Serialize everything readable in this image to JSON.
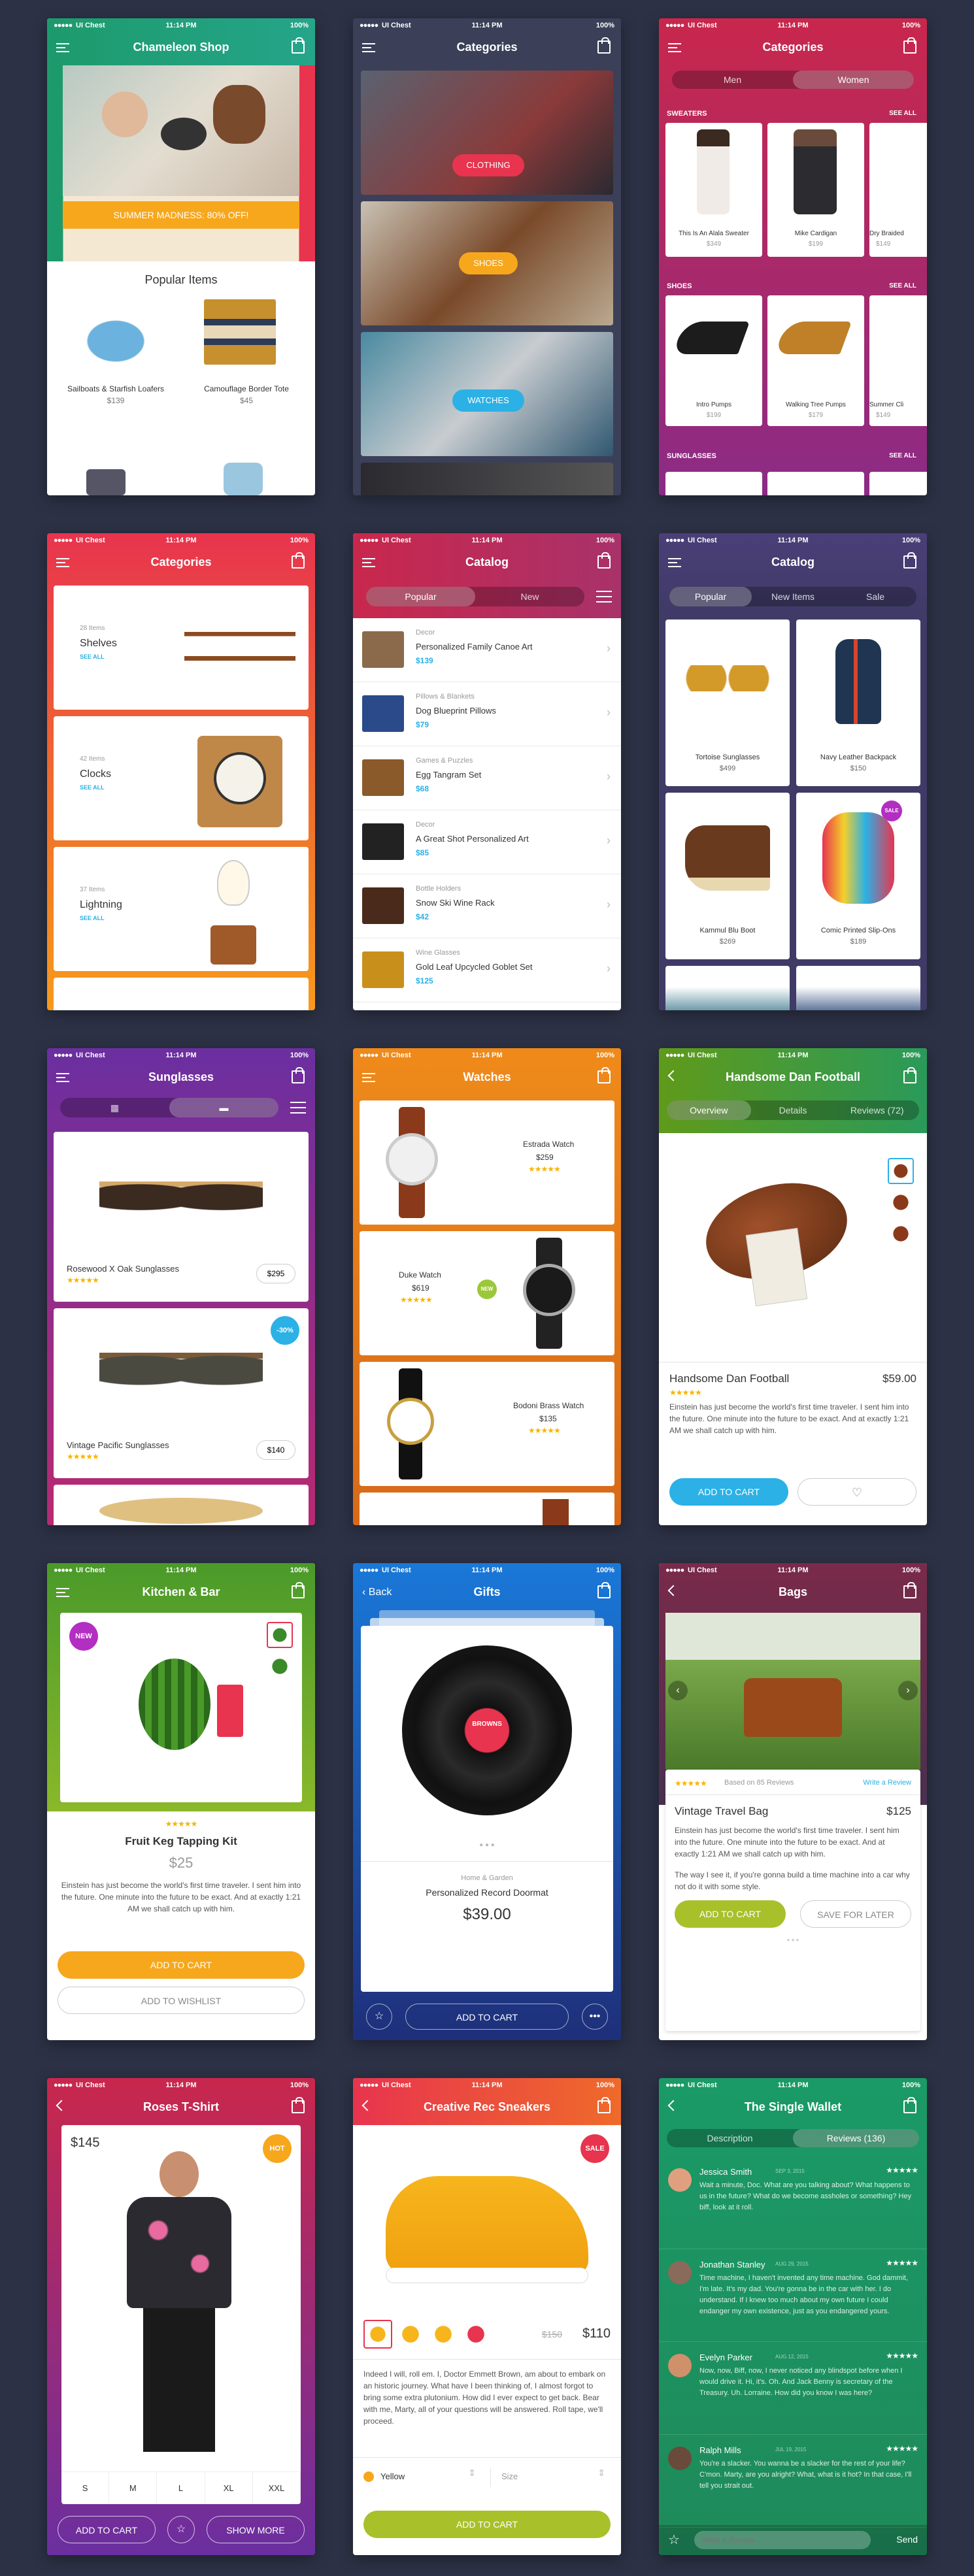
{
  "status": {
    "carrier": "UI Chest",
    "time": "11:14 PM",
    "battery": "100%"
  },
  "s1": {
    "title": "Chameleon Shop",
    "banner": "SUMMER MADNESS: 80% OFF!",
    "section": "Popular Items",
    "items": [
      {
        "name": "Sailboats & Starfish Loafers",
        "price": "$139"
      },
      {
        "name": "Camouflage Border Tote",
        "price": "$45"
      }
    ]
  },
  "s2": {
    "title": "Categories",
    "items": [
      "CLOTHING",
      "SHOES",
      "WATCHES"
    ]
  },
  "s3": {
    "title": "Categories",
    "tabs": [
      "Men",
      "Women"
    ],
    "sections": [
      {
        "label": "SWEATERS",
        "see": "SEE ALL",
        "items": [
          {
            "name": "This Is An Alala Sweater",
            "price": "$349"
          },
          {
            "name": "Mike Cardigan",
            "price": "$199"
          },
          {
            "name": "Dry Braided",
            "price": "$149"
          }
        ]
      },
      {
        "label": "SHOES",
        "see": "SEE ALL",
        "items": [
          {
            "name": "Intro Pumps",
            "price": "$199"
          },
          {
            "name": "Walking Tree Pumps",
            "price": "$179"
          },
          {
            "name": "Summer Cli",
            "price": "$149"
          }
        ]
      },
      {
        "label": "SUNGLASSES",
        "see": "SEE ALL"
      }
    ]
  },
  "s4": {
    "title": "Categories",
    "items": [
      {
        "count": "28 Items",
        "name": "Shelves",
        "see": "SEE ALL"
      },
      {
        "count": "42 Items",
        "name": "Clocks",
        "see": "SEE ALL"
      },
      {
        "count": "37 Items",
        "name": "Lightning",
        "see": "SEE ALL"
      }
    ]
  },
  "s5": {
    "title": "Catalog",
    "tabs": [
      "Popular",
      "New"
    ],
    "items": [
      {
        "cat": "Decor",
        "name": "Personalized Family Canoe Art",
        "price": "$139"
      },
      {
        "cat": "Pillows & Blankets",
        "name": "Dog Blueprint Pillows",
        "price": "$79"
      },
      {
        "cat": "Games & Puzzles",
        "name": "Egg Tangram Set",
        "price": "$68"
      },
      {
        "cat": "Decor",
        "name": "A Great Shot Personalized Art",
        "price": "$85"
      },
      {
        "cat": "Bottle Holders",
        "name": "Snow Ski Wine Rack",
        "price": "$42"
      },
      {
        "cat": "Wine Glasses",
        "name": "Gold Leaf Upcycled Goblet Set",
        "price": "$125"
      }
    ]
  },
  "s6": {
    "title": "Catalog",
    "tabs": [
      "Popular",
      "New Items",
      "Sale"
    ],
    "items": [
      {
        "name": "Tortoise Sunglasses",
        "price": "$499"
      },
      {
        "name": "Navy Leather Backpack",
        "price": "$150"
      },
      {
        "name": "Kammul Blu Boot",
        "price": "$269"
      },
      {
        "name": "Comic Printed Slip-Ons",
        "price": "$189"
      }
    ],
    "sale": "SALE"
  },
  "s7": {
    "title": "Sunglasses",
    "items": [
      {
        "name": "Rosewood X Oak Sunglasses",
        "price": "$295",
        "stars": "★★★★★"
      },
      {
        "name": "Vintage Pacific Sunglasses",
        "price": "$140",
        "stars": "★★★★★",
        "badge": "-30%"
      }
    ]
  },
  "s8": {
    "title": "Watches",
    "items": [
      {
        "name": "Estrada Watch",
        "price": "$259",
        "stars": "★★★★★"
      },
      {
        "name": "Duke Watch",
        "price": "$619",
        "stars": "★★★★★",
        "badge": "NEW"
      },
      {
        "name": "Bodoni Brass Watch",
        "price": "$135",
        "stars": "★★★★★"
      }
    ]
  },
  "s9": {
    "title": "Handsome Dan Football",
    "tabs": [
      "Overview",
      "Details",
      "Reviews (72)"
    ],
    "name": "Handsome Dan Football",
    "price": "$59.00",
    "stars": "★★★★★",
    "desc": "Einstein has just become the world's first time traveler. I sent him into the future. One minute into the future to be exact. And at exactly 1:21 AM we shall catch up with him.",
    "cta": "ADD TO CART"
  },
  "s10": {
    "title": "Kitchen & Bar",
    "badge": "NEW",
    "stars": "★★★★★",
    "name": "Fruit Keg Tapping Kit",
    "price": "$25",
    "desc": "Einstein has just become the world's first time traveler. I sent him into the future. One minute into the future to be exact. And at exactly 1:21 AM we shall catch up with him.",
    "cta": "ADD TO CART",
    "cta2": "ADD TO WISHLIST"
  },
  "s11": {
    "title": "Gifts",
    "back": "Back",
    "record": "BROWNS",
    "cat": "Home & Garden",
    "name": "Personalized Record Doormat",
    "price": "$39.00",
    "cta": "ADD TO CART"
  },
  "s12": {
    "title": "Bags",
    "stars": "★★★★★",
    "reviews": "Based on 85 Reviews",
    "write": "Write a Review",
    "name": "Vintage Travel Bag",
    "price": "$125",
    "desc": "Einstein has just become the world's first time traveler. I sent him into the future. One minute into the future to be exact. And at exactly 1:21 AM we shall catch up with him.",
    "desc2": "The way I see it, if you're gonna build a time machine into a car why not do it with some style.",
    "cta": "ADD TO CART",
    "cta2": "SAVE FOR LATER"
  },
  "s13": {
    "title": "Roses T-Shirt",
    "price": "$145",
    "badge": "HOT",
    "sizes": [
      "S",
      "M",
      "L",
      "XL",
      "XXL"
    ],
    "cta": "ADD TO CART",
    "cta2": "SHOW MORE"
  },
  "s14": {
    "title": "Creative Rec Sneakers",
    "badge": "SALE",
    "old": "$150",
    "price": "$110",
    "desc": "Indeed I will, roll em. I, Doctor Emmett Brown, am about to embark on an historic journey. What have I been thinking of, I almost forgot to bring some extra plutonium. How did I ever expect to get back. Bear with me, Marty, all of your questions will be answered. Roll tape, we'll proceed.",
    "color": "Yellow",
    "size": "Size",
    "cta": "ADD TO CART"
  },
  "s15": {
    "title": "The Single Wallet",
    "tabs": [
      "Description",
      "Reviews (136)"
    ],
    "reviews": [
      {
        "name": "Jessica Smith",
        "date": "SEP 3, 2015",
        "stars": "★★★★★",
        "text": "Wait a minute, Doc. What are you talking about? What happens to us in the future? What do we become assholes or something? Hey biff, look at it roll."
      },
      {
        "name": "Jonathan Stanley",
        "date": "AUG 29, 2015",
        "stars": "★★★★★",
        "text": "Time machine, I haven't invented any time machine. God dammit, I'm late. It's my dad. You're gonna be in the car with her. I do understand. If I knew too much about my own future I could endanger my own existence, just as you endangered yours."
      },
      {
        "name": "Evelyn Parker",
        "date": "AUG 12, 2015",
        "stars": "★★★★★",
        "text": "Now, now, Biff, now, I never noticed any blindspot before when I would drive it. Hi, it's. Oh. And Jack Benny is secretary of the Treasury. Uh. Lorraine. How did you know I was here?"
      },
      {
        "name": "Ralph Mills",
        "date": "JUL 19, 2015",
        "stars": "★★★★★",
        "text": "You're a slacker. You wanna be a slacker for the rest of your life? C'mon. Marty, are you alright? What, what is it hot? In that case, I'll tell you strait out."
      }
    ],
    "placeholder": "Write a Review...",
    "send": "Send"
  },
  "colors": {
    "green": "#1a9a67",
    "orange": "#f39c12",
    "blue": "#2bb1e6",
    "red": "#e8344e"
  }
}
